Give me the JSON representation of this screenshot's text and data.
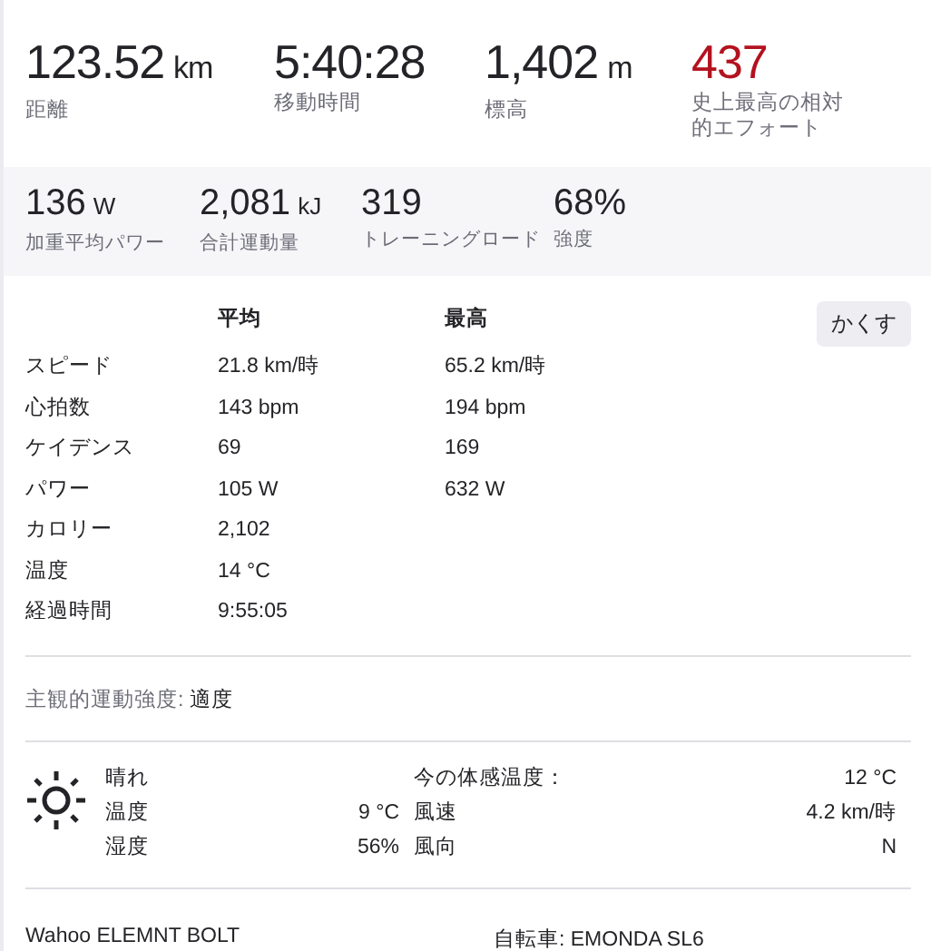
{
  "primary_stats": [
    {
      "value": "123.52",
      "unit": "km",
      "label": "距離",
      "highlight": false
    },
    {
      "value": "5:40:28",
      "label": "移動時間",
      "highlight": false
    },
    {
      "value": "1,402",
      "unit": "m",
      "label": "標高",
      "highlight": false
    },
    {
      "value": "437",
      "label": "史上最高の相対的エフォート",
      "highlight": true
    }
  ],
  "secondary_stats": [
    {
      "value": "136",
      "unit": "W",
      "label": "加重平均パワー"
    },
    {
      "value": "2,081",
      "unit": "kJ",
      "label": "合計運動量"
    },
    {
      "value": "319",
      "label": "トレーニングロード"
    },
    {
      "value": "68%",
      "label": "強度"
    }
  ],
  "details": {
    "columns": [
      "平均",
      "最高"
    ],
    "hide_button": "かくす",
    "rows": [
      {
        "label": "スピード",
        "avg": "21.8 km/時",
        "max": "65.2 km/時"
      },
      {
        "label": "心拍数",
        "avg": "143 bpm",
        "max": "194 bpm"
      },
      {
        "label": "ケイデンス",
        "avg": "69",
        "max": "169"
      },
      {
        "label": "パワー",
        "avg": "105 W",
        "max": "632 W"
      },
      {
        "label": "カロリー",
        "avg": "2,102"
      },
      {
        "label": "温度",
        "avg": "14 °C"
      },
      {
        "label": "経過時間",
        "avg": "9:55:05"
      }
    ]
  },
  "perceived_exertion": {
    "label": "主観的運動強度:",
    "value": "適度"
  },
  "weather": {
    "condition": "晴れ",
    "left": [
      {
        "label": "温度",
        "value": "9 °C"
      },
      {
        "label": "湿度",
        "value": "56%"
      }
    ],
    "right": [
      {
        "label": "今の体感温度：",
        "value": "12 °C"
      },
      {
        "label": "風速",
        "value": "4.2 km/時"
      },
      {
        "label": "風向",
        "value": "N"
      }
    ]
  },
  "footer": {
    "device": "Wahoo ELEMNT BOLT",
    "bike": "自転車: EMONDA SL6"
  }
}
